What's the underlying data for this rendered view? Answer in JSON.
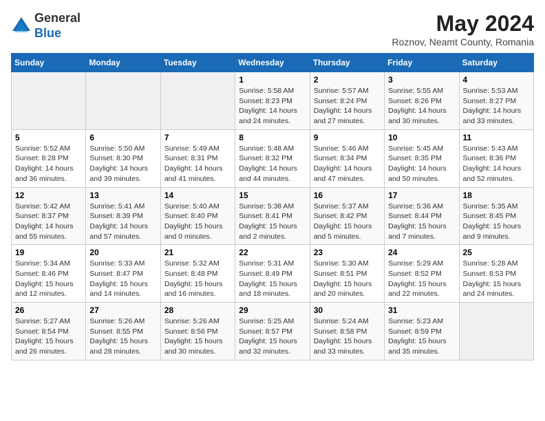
{
  "header": {
    "logo": {
      "line1": "General",
      "line2": "Blue"
    },
    "title": "May 2024",
    "location": "Roznov, Neamt County, Romania"
  },
  "days_of_week": [
    "Sunday",
    "Monday",
    "Tuesday",
    "Wednesday",
    "Thursday",
    "Friday",
    "Saturday"
  ],
  "weeks": [
    [
      {
        "day": "",
        "detail": ""
      },
      {
        "day": "",
        "detail": ""
      },
      {
        "day": "",
        "detail": ""
      },
      {
        "day": "1",
        "detail": "Sunrise: 5:58 AM\nSunset: 8:23 PM\nDaylight: 14 hours\nand 24 minutes."
      },
      {
        "day": "2",
        "detail": "Sunrise: 5:57 AM\nSunset: 8:24 PM\nDaylight: 14 hours\nand 27 minutes."
      },
      {
        "day": "3",
        "detail": "Sunrise: 5:55 AM\nSunset: 8:26 PM\nDaylight: 14 hours\nand 30 minutes."
      },
      {
        "day": "4",
        "detail": "Sunrise: 5:53 AM\nSunset: 8:27 PM\nDaylight: 14 hours\nand 33 minutes."
      }
    ],
    [
      {
        "day": "5",
        "detail": "Sunrise: 5:52 AM\nSunset: 8:28 PM\nDaylight: 14 hours\nand 36 minutes."
      },
      {
        "day": "6",
        "detail": "Sunrise: 5:50 AM\nSunset: 8:30 PM\nDaylight: 14 hours\nand 39 minutes."
      },
      {
        "day": "7",
        "detail": "Sunrise: 5:49 AM\nSunset: 8:31 PM\nDaylight: 14 hours\nand 41 minutes."
      },
      {
        "day": "8",
        "detail": "Sunrise: 5:48 AM\nSunset: 8:32 PM\nDaylight: 14 hours\nand 44 minutes."
      },
      {
        "day": "9",
        "detail": "Sunrise: 5:46 AM\nSunset: 8:34 PM\nDaylight: 14 hours\nand 47 minutes."
      },
      {
        "day": "10",
        "detail": "Sunrise: 5:45 AM\nSunset: 8:35 PM\nDaylight: 14 hours\nand 50 minutes."
      },
      {
        "day": "11",
        "detail": "Sunrise: 5:43 AM\nSunset: 8:36 PM\nDaylight: 14 hours\nand 52 minutes."
      }
    ],
    [
      {
        "day": "12",
        "detail": "Sunrise: 5:42 AM\nSunset: 8:37 PM\nDaylight: 14 hours\nand 55 minutes."
      },
      {
        "day": "13",
        "detail": "Sunrise: 5:41 AM\nSunset: 8:39 PM\nDaylight: 14 hours\nand 57 minutes."
      },
      {
        "day": "14",
        "detail": "Sunrise: 5:40 AM\nSunset: 8:40 PM\nDaylight: 15 hours\nand 0 minutes."
      },
      {
        "day": "15",
        "detail": "Sunrise: 5:38 AM\nSunset: 8:41 PM\nDaylight: 15 hours\nand 2 minutes."
      },
      {
        "day": "16",
        "detail": "Sunrise: 5:37 AM\nSunset: 8:42 PM\nDaylight: 15 hours\nand 5 minutes."
      },
      {
        "day": "17",
        "detail": "Sunrise: 5:36 AM\nSunset: 8:44 PM\nDaylight: 15 hours\nand 7 minutes."
      },
      {
        "day": "18",
        "detail": "Sunrise: 5:35 AM\nSunset: 8:45 PM\nDaylight: 15 hours\nand 9 minutes."
      }
    ],
    [
      {
        "day": "19",
        "detail": "Sunrise: 5:34 AM\nSunset: 8:46 PM\nDaylight: 15 hours\nand 12 minutes."
      },
      {
        "day": "20",
        "detail": "Sunrise: 5:33 AM\nSunset: 8:47 PM\nDaylight: 15 hours\nand 14 minutes."
      },
      {
        "day": "21",
        "detail": "Sunrise: 5:32 AM\nSunset: 8:48 PM\nDaylight: 15 hours\nand 16 minutes."
      },
      {
        "day": "22",
        "detail": "Sunrise: 5:31 AM\nSunset: 8:49 PM\nDaylight: 15 hours\nand 18 minutes."
      },
      {
        "day": "23",
        "detail": "Sunrise: 5:30 AM\nSunset: 8:51 PM\nDaylight: 15 hours\nand 20 minutes."
      },
      {
        "day": "24",
        "detail": "Sunrise: 5:29 AM\nSunset: 8:52 PM\nDaylight: 15 hours\nand 22 minutes."
      },
      {
        "day": "25",
        "detail": "Sunrise: 5:28 AM\nSunset: 8:53 PM\nDaylight: 15 hours\nand 24 minutes."
      }
    ],
    [
      {
        "day": "26",
        "detail": "Sunrise: 5:27 AM\nSunset: 8:54 PM\nDaylight: 15 hours\nand 26 minutes."
      },
      {
        "day": "27",
        "detail": "Sunrise: 5:26 AM\nSunset: 8:55 PM\nDaylight: 15 hours\nand 28 minutes."
      },
      {
        "day": "28",
        "detail": "Sunrise: 5:26 AM\nSunset: 8:56 PM\nDaylight: 15 hours\nand 30 minutes."
      },
      {
        "day": "29",
        "detail": "Sunrise: 5:25 AM\nSunset: 8:57 PM\nDaylight: 15 hours\nand 32 minutes."
      },
      {
        "day": "30",
        "detail": "Sunrise: 5:24 AM\nSunset: 8:58 PM\nDaylight: 15 hours\nand 33 minutes."
      },
      {
        "day": "31",
        "detail": "Sunrise: 5:23 AM\nSunset: 8:59 PM\nDaylight: 15 hours\nand 35 minutes."
      },
      {
        "day": "",
        "detail": ""
      }
    ]
  ]
}
